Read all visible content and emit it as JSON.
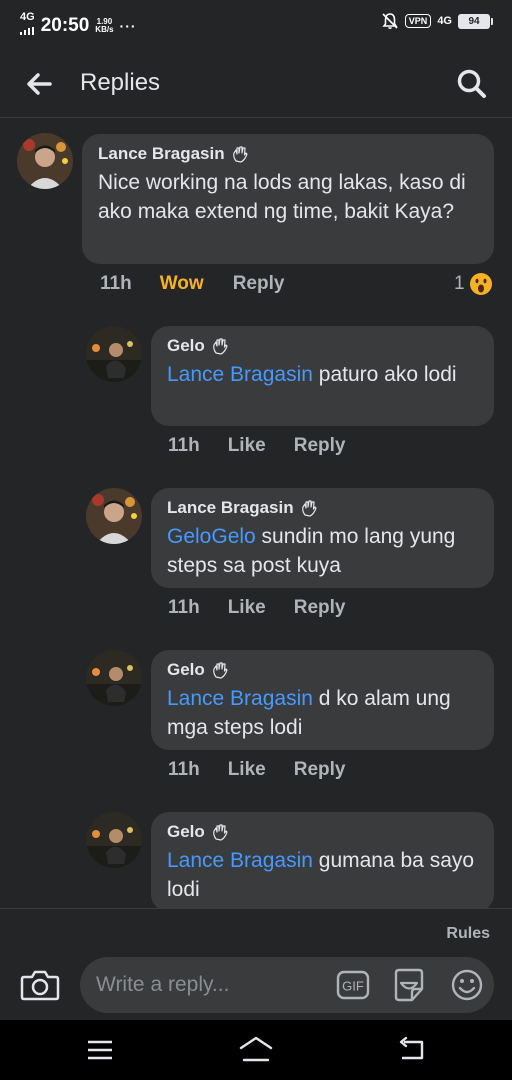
{
  "status_bar": {
    "network": "4G",
    "time": "20:50",
    "speed_value": "1.90",
    "speed_unit": "KB/s",
    "dots": "···",
    "vpn": "VPN",
    "network_right": "4G",
    "battery": "94"
  },
  "header": {
    "title": "Replies",
    "back_icon": "back-arrow-icon",
    "search_icon": "search-icon"
  },
  "main_comment": {
    "author": "Lance Bragasin",
    "text": "Nice working na lods ang lakas, kaso di ako maka extend ng time, bakit Kaya?",
    "time": "11h",
    "reaction_label": "Wow",
    "reply_label": "Reply",
    "reaction_count": "1"
  },
  "replies": [
    {
      "author": "Gelo",
      "mention": "Lance Bragasin",
      "text": " paturo ako lodi",
      "time": "11h",
      "like_label": "Like",
      "reply_label": "Reply"
    },
    {
      "author": "Lance Bragasin",
      "mention": "GeloGelo",
      "text": " sundin mo lang yung steps sa post kuya",
      "time": "11h",
      "like_label": "Like",
      "reply_label": "Reply"
    },
    {
      "author": "Gelo",
      "mention": "Lance Bragasin",
      "text": " d ko alam ung mga steps lodi",
      "time": "11h",
      "like_label": "Like",
      "reply_label": "Reply"
    },
    {
      "author": "Gelo",
      "mention": "Lance Bragasin",
      "text": " gumana ba sayo lodi"
    }
  ],
  "composer": {
    "rules_label": "Rules",
    "placeholder": "Write a reply...",
    "gif_label": "GIF"
  },
  "colors": {
    "background": "#242526",
    "bubble": "#3a3b3c",
    "mention": "#4599ff",
    "wow": "#f7b125",
    "muted": "#b0b3b8"
  }
}
